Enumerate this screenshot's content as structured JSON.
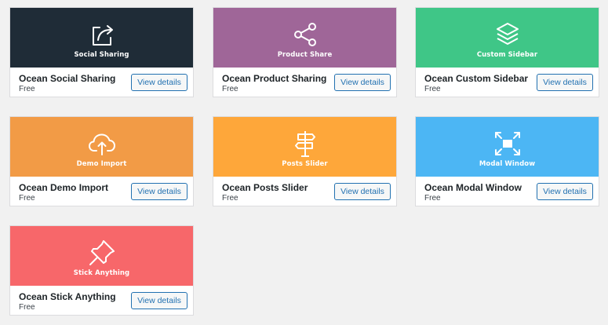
{
  "cards": [
    {
      "title": "Ocean Social Sharing",
      "price": "Free",
      "button": "View details",
      "banner_label": "Social Sharing",
      "color": "#1f2c37",
      "icon": "share-arrow-icon"
    },
    {
      "title": "Ocean Product Sharing",
      "price": "Free",
      "button": "View details",
      "banner_label": "Product Share",
      "color": "#9f6698",
      "icon": "share-nodes-icon"
    },
    {
      "title": "Ocean Custom Sidebar",
      "price": "Free",
      "button": "View details",
      "banner_label": "Custom Sidebar",
      "color": "#3fc687",
      "icon": "layers-icon"
    },
    {
      "title": "Ocean Demo Import",
      "price": "Free",
      "button": "View details",
      "banner_label": "Demo Import",
      "color": "#f29b46",
      "icon": "cloud-upload-icon"
    },
    {
      "title": "Ocean Posts Slider",
      "price": "Free",
      "button": "View details",
      "banner_label": "Posts Slider",
      "color": "#fea73a",
      "icon": "signpost-icon"
    },
    {
      "title": "Ocean Modal Window",
      "price": "Free",
      "button": "View details",
      "banner_label": "Modal Window",
      "color": "#4cb6f4",
      "icon": "expand-arrows-icon"
    },
    {
      "title": "Ocean Stick Anything",
      "price": "Free",
      "button": "View details",
      "banner_label": "Stick Anything",
      "color": "#f7676a",
      "icon": "pushpin-icon"
    }
  ]
}
